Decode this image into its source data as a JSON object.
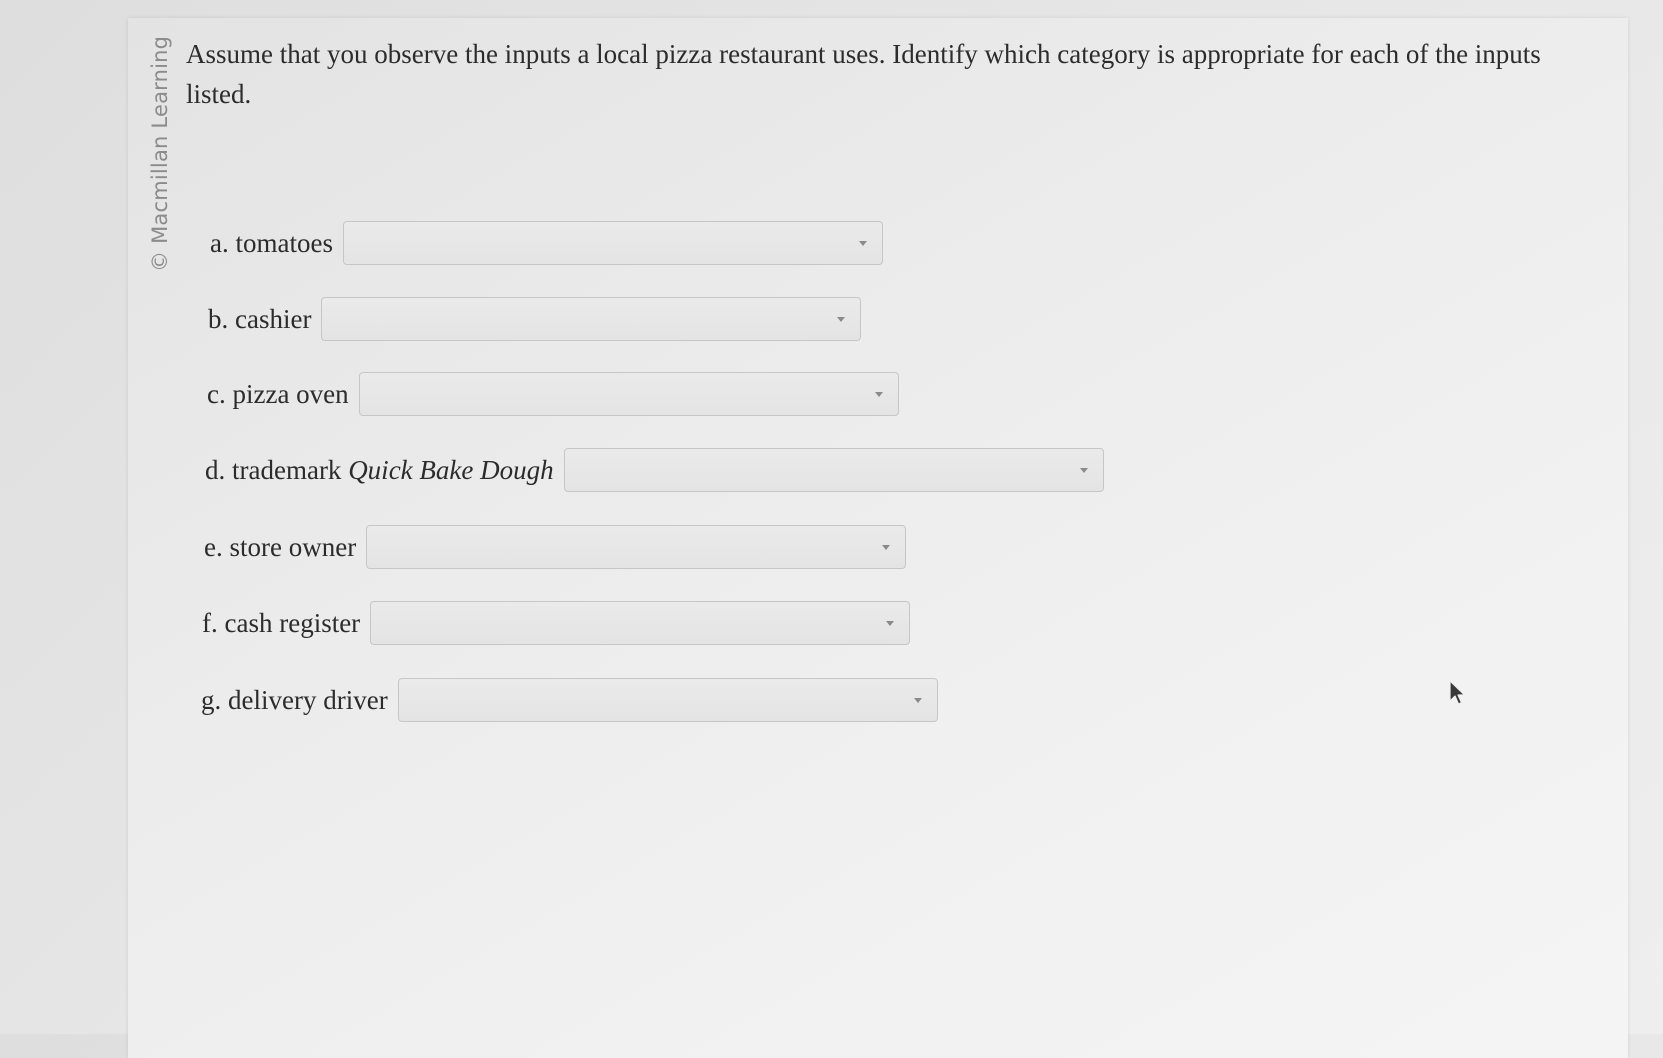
{
  "watermark": "© Macmillan Learning",
  "question": "Assume that you observe the inputs a local pizza restaurant uses. Identify which category is appropriate for each of the inputs listed.",
  "items": [
    {
      "label": "a. tomatoes",
      "selected": ""
    },
    {
      "label": "b. cashier",
      "selected": ""
    },
    {
      "label": "c. pizza oven",
      "selected": ""
    },
    {
      "label_prefix": "d. trademark ",
      "label_italic": "Quick Bake Dough",
      "selected": ""
    },
    {
      "label": "e. store owner",
      "selected": ""
    },
    {
      "label": "f. cash register",
      "selected": ""
    },
    {
      "label": "g. delivery driver",
      "selected": ""
    }
  ],
  "icons": {
    "dropdown": "chevron-down-icon",
    "pointer": "mouse-pointer-icon"
  }
}
